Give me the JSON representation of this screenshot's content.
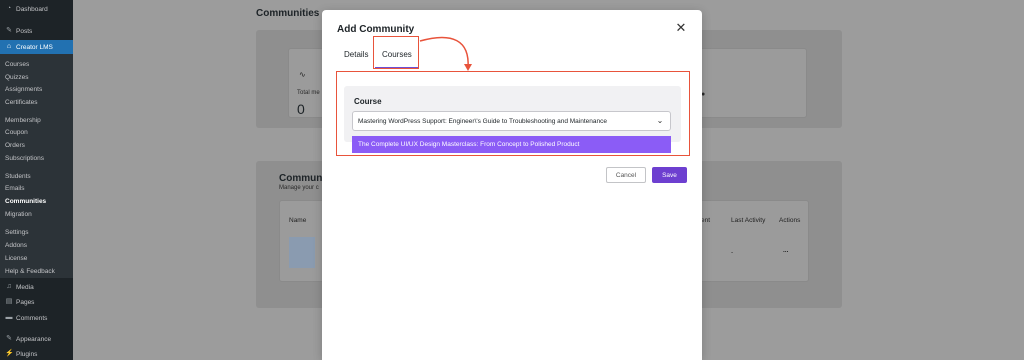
{
  "sidebar": {
    "dashboard": "Dashboard",
    "posts": "Posts",
    "creator_lms": "Creator LMS",
    "sub": [
      "Courses",
      "Quizzes",
      "Assignments",
      "Certificates",
      "Membership",
      "Coupon",
      "Orders",
      "Subscriptions",
      "Students",
      "Emails",
      "Communities",
      "Migration",
      "Settings",
      "Addons",
      "License",
      "Help & Feedback"
    ],
    "media": "Media",
    "pages": "Pages",
    "comments": "Comments",
    "appearance": "Appearance",
    "plugins": "Plugins"
  },
  "background": {
    "page_title": "Communities",
    "stat_label": "Total me",
    "stat_value": "0",
    "section_title": "Communi",
    "section_subtitle": "Manage your c",
    "col_name": "Name",
    "col_management": "ement",
    "col_last_activity": "Last Activity",
    "col_actions": "Actions",
    "row_last_activity": "-",
    "row_actions": "..."
  },
  "modal": {
    "title": "Add Community",
    "tabs": [
      "Details",
      "Courses"
    ],
    "active_tab": "Courses",
    "course_label": "Course",
    "selected_course": "Mastering WordPress Support: Engineer\\'s Guide to Troubleshooting and Maintenance",
    "dropdown_option": "The Complete UI/UX Design Masterclass: From Concept to Polished Product",
    "cancel_label": "Cancel",
    "save_label": "Save"
  },
  "colors": {
    "accent": "#6d3fd0",
    "annotation": "#e8533b",
    "sidebar_bg": "#1d2327",
    "highlight_option": "#8b5cf6"
  }
}
